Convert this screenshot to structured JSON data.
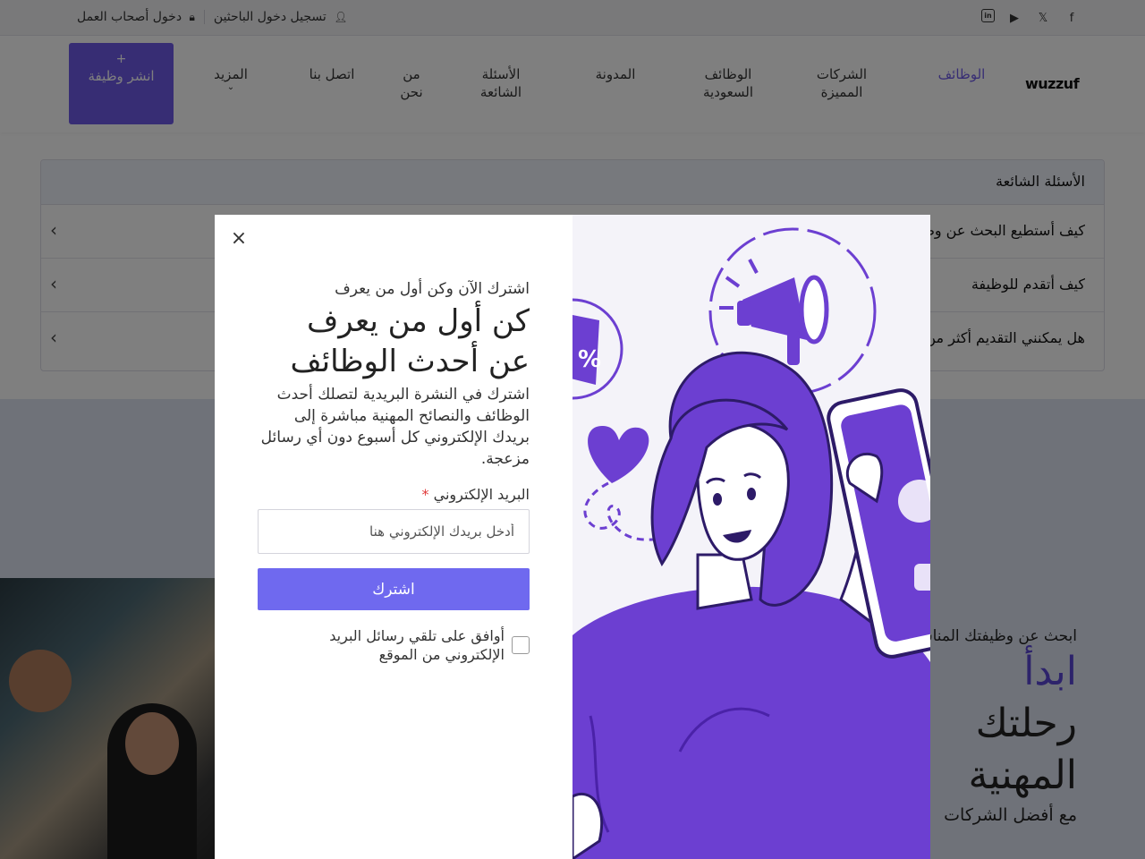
{
  "topbar": {
    "employer_login": "دخول أصحاب العمل",
    "job_seeker_login": "تسجيل دخول الباحثين"
  },
  "header": {
    "post_job": "انشر وظيفة",
    "post_job_plus": "+",
    "nav": [
      {
        "label": "الوظائف",
        "active": true
      },
      {
        "label": "الشركات المميزة"
      },
      {
        "label": "الوظائف السعودية"
      },
      {
        "label": "المدونة"
      },
      {
        "label": "الأسئلة الشائعة"
      },
      {
        "label": "من نحن"
      },
      {
        "label": "اتصل بنا"
      },
      {
        "label": "المزيد"
      }
    ],
    "logo": "wuzzuf"
  },
  "accordion": {
    "header": "الأسئلة الشائعة",
    "rows": [
      "كيف أستطيع البحث عن وظيفة",
      "كيف أتقدم للوظيفة",
      "هل يمكنني التقديم أكثر من مرة"
    ]
  },
  "hero": {
    "subtitle": "ابحث عن وظيفتك المناسبة",
    "line1": "ابدأ",
    "line2": "رحلتك",
    "line3": "المهنية",
    "footer": "مع أفضل الشركات"
  },
  "modal": {
    "close": "×",
    "eyebrow": "اشترك الآن وكن أول من يعرف",
    "title": "كن أول من يعرف عن أحدث الوظائف",
    "description": "اشترك في النشرة البريدية لتصلك أحدث الوظائف والنصائح المهنية مباشرة إلى بريدك الإلكتروني كل أسبوع دون أي رسائل مزعجة.",
    "email_label": "البريد الإلكتروني",
    "email_required": "*",
    "email_placeholder": "أدخل بريدك الإلكتروني هنا",
    "submit": "اشترك",
    "consent": "أوافق على تلقي رسائل البريد الإلكتروني من الموقع"
  },
  "colors": {
    "brand": "#6f5ae8",
    "button": "#6f69ef",
    "illustration_purple": "#6c3fd1",
    "overlay": "rgba(0,0,0,0.5)"
  },
  "icons": {
    "lock": "lock-icon",
    "user": "user-icon",
    "linkedin": "linkedin-icon",
    "youtube": "youtube-icon",
    "x": "x-icon",
    "facebook": "facebook-icon"
  }
}
